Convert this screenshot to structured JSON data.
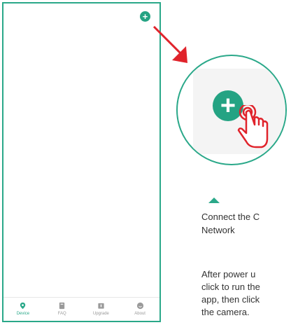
{
  "phone": {
    "add_button_icon": "plus-icon",
    "tabs": [
      {
        "label": "Device",
        "icon": "location-pin-icon",
        "active": true
      },
      {
        "label": "FAQ",
        "icon": "book-icon",
        "active": false
      },
      {
        "label": "Upgrade",
        "icon": "upgrade-icon",
        "active": false
      },
      {
        "label": "About",
        "icon": "smiley-icon",
        "active": false
      }
    ]
  },
  "callout": {
    "zoom_button_icon": "plus-icon",
    "gesture_icon": "hand-tap-icon"
  },
  "instructions": {
    "title": "Connect the C\nNetwork",
    "body": "After power u\nclick to run the\napp, then click\nthe camera."
  },
  "colors": {
    "accent": "#2aa889",
    "arrow": "#e0232b"
  }
}
